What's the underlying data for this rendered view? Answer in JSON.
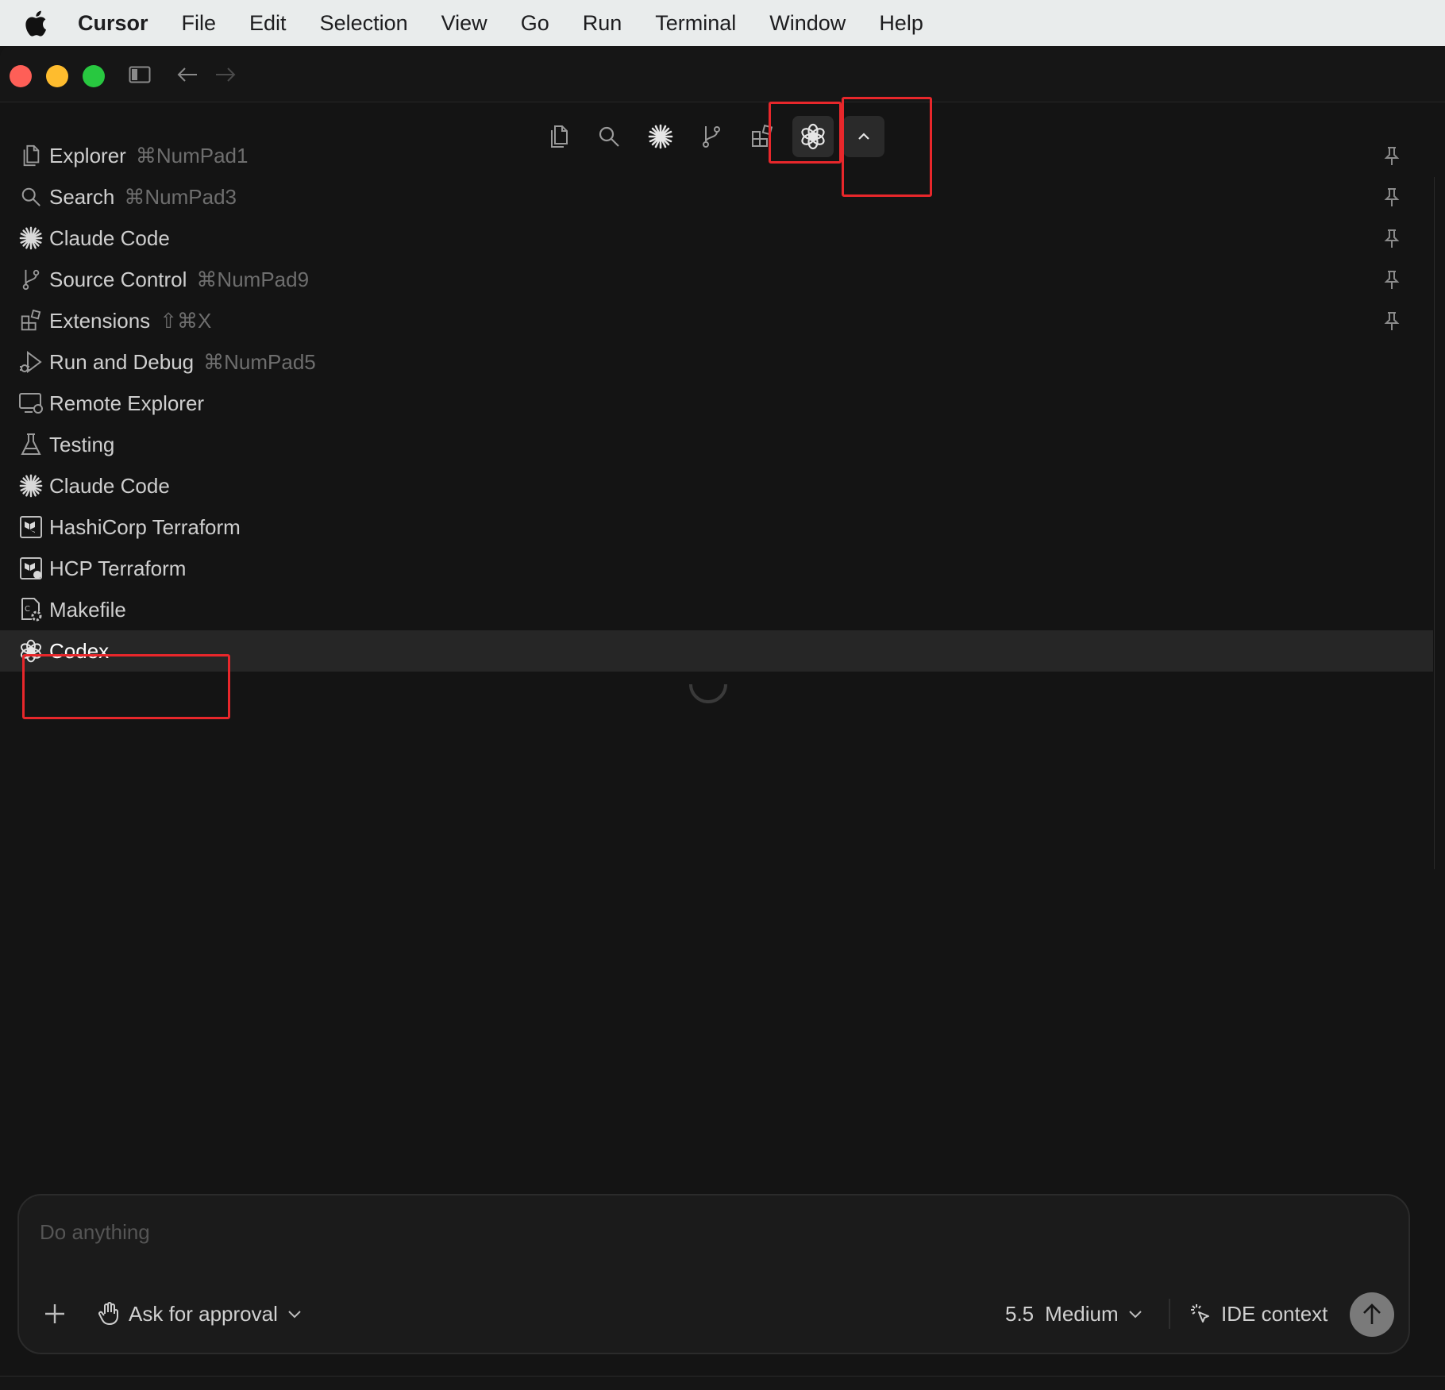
{
  "menubar": {
    "app_name": "Cursor",
    "items": [
      "File",
      "Edit",
      "Selection",
      "View",
      "Go",
      "Run",
      "Terminal",
      "Window",
      "Help"
    ]
  },
  "views": [
    {
      "label": "Explorer",
      "shortcut": "⌘NumPad1",
      "icon": "files-icon",
      "pinned": true
    },
    {
      "label": "Search",
      "shortcut": "⌘NumPad3",
      "icon": "search-icon",
      "pinned": true
    },
    {
      "label": "Claude Code",
      "shortcut": "",
      "icon": "claude-spark-icon",
      "pinned": true
    },
    {
      "label": "Source Control",
      "shortcut": "⌘NumPad9",
      "icon": "source-control-icon",
      "pinned": true
    },
    {
      "label": "Extensions",
      "shortcut": "⇧⌘X",
      "icon": "extensions-icon",
      "pinned": true
    },
    {
      "label": "Run and Debug",
      "shortcut": "⌘NumPad5",
      "icon": "run-debug-icon",
      "pinned": false
    },
    {
      "label": "Remote Explorer",
      "shortcut": "",
      "icon": "remote-explorer-icon",
      "pinned": false
    },
    {
      "label": "Testing",
      "shortcut": "",
      "icon": "beaker-icon",
      "pinned": false
    },
    {
      "label": "Claude Code",
      "shortcut": "",
      "icon": "claude-spark-icon",
      "pinned": false
    },
    {
      "label": "HashiCorp Terraform",
      "shortcut": "",
      "icon": "terraform-icon",
      "pinned": false
    },
    {
      "label": "HCP Terraform",
      "shortcut": "",
      "icon": "hcp-terraform-icon",
      "pinned": false
    },
    {
      "label": "Makefile",
      "shortcut": "",
      "icon": "makefile-icon",
      "pinned": false
    },
    {
      "label": "Codex",
      "shortcut": "",
      "icon": "openai-icon",
      "pinned": false,
      "selected": true
    }
  ],
  "composer": {
    "placeholder": "Do anything",
    "approval_label": "Ask for approval",
    "model_version": "5.5",
    "model_effort": "Medium",
    "ide_context_label": "IDE context"
  },
  "colors": {
    "highlight": "#e8272b",
    "background": "#141414",
    "selected_row": "#262626"
  }
}
